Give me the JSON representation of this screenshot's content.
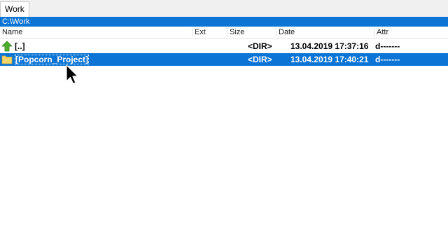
{
  "tab": {
    "label": "Work"
  },
  "path": {
    "text": "C:\\Work"
  },
  "columns": {
    "name": "Name",
    "ext": "Ext",
    "size": "Size",
    "date": "Date",
    "attr": "Attr"
  },
  "rows": [
    {
      "name": "[..]",
      "ext": "",
      "size": "<DIR>",
      "date": "13.04.2019 17:37:16",
      "attr": "d-------",
      "icon": "up-arrow-icon",
      "selected": false
    },
    {
      "name": "[Popcorn_Project]",
      "ext": "",
      "size": "<DIR>",
      "date": "13.04.2019 17:40:21",
      "attr": "d-------",
      "icon": "folder-icon",
      "selected": true
    }
  ],
  "colors": {
    "accent": "#0b74d5",
    "up_arrow": "#4caf2a",
    "folder": "#f2d66b"
  }
}
